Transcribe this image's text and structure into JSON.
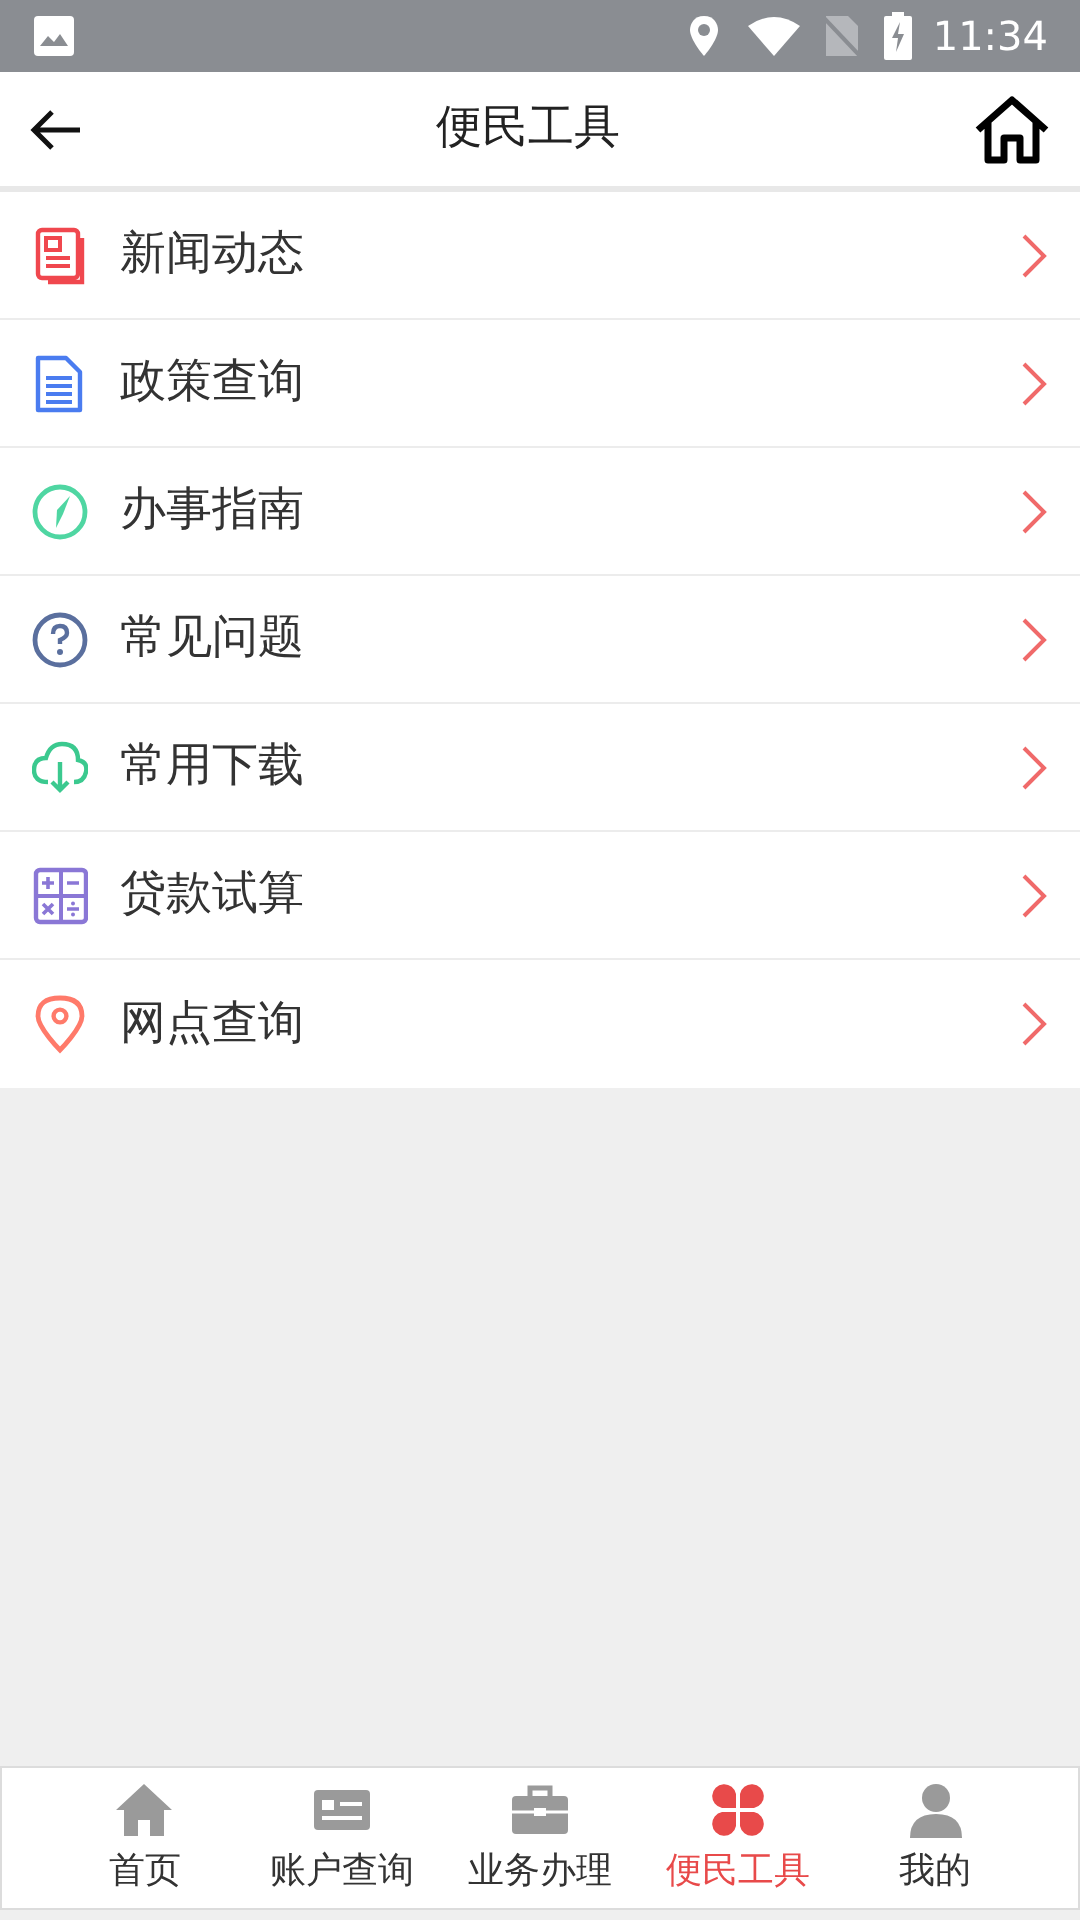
{
  "status_bar": {
    "time": "11:34"
  },
  "header": {
    "title": "便民工具"
  },
  "items": [
    {
      "label": "新闻动态"
    },
    {
      "label": "政策查询"
    },
    {
      "label": "办事指南"
    },
    {
      "label": "常见问题"
    },
    {
      "label": "常用下载"
    },
    {
      "label": "贷款试算"
    },
    {
      "label": "网点查询"
    }
  ],
  "tab_bar": [
    {
      "label": "首页",
      "selected": false
    },
    {
      "label": "账户查询",
      "selected": false
    },
    {
      "label": "业务办理",
      "selected": false
    },
    {
      "label": "便民工具",
      "selected": true
    },
    {
      "label": "我的",
      "selected": false
    }
  ]
}
